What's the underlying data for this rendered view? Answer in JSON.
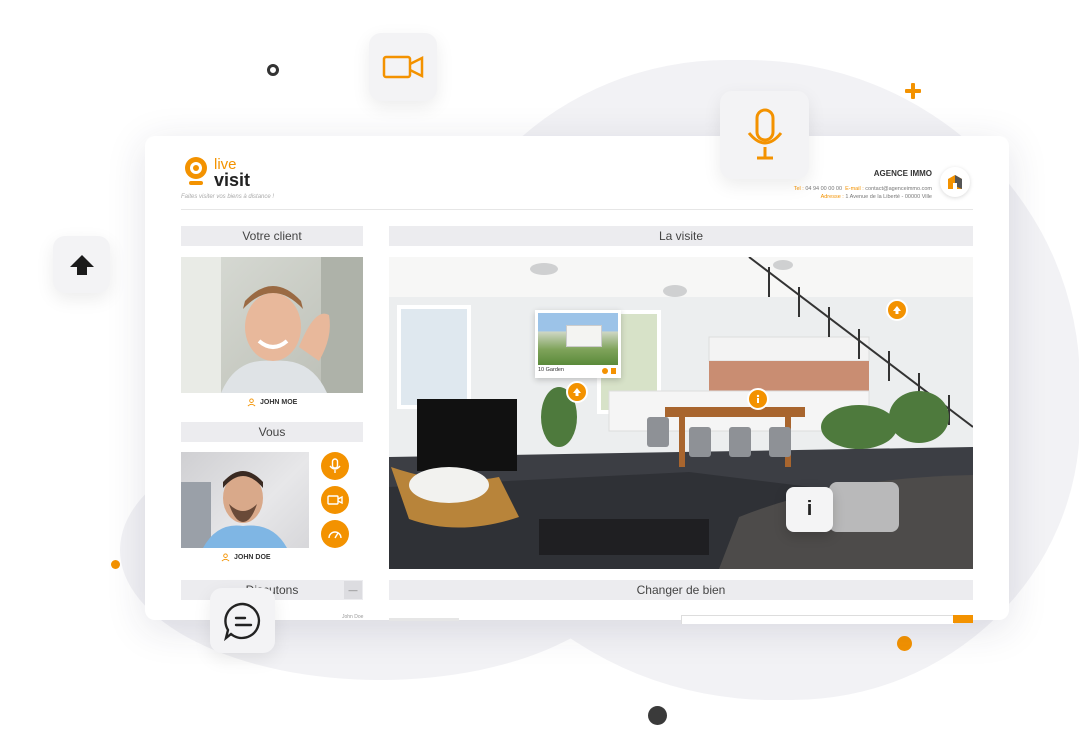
{
  "app": {
    "logo_live": "live",
    "logo_visit": "visit",
    "tagline": "Faites visiter vos biens à distance !"
  },
  "agency": {
    "name": "AGENCE IMMO",
    "tel_label": "Tel :",
    "tel": "04 94 00 00 00",
    "email_label": "E-mail :",
    "email": "contact@agenceimmo.com",
    "address_label": "Adresse :",
    "address": "1 Avenue de la Liberté - 00000 Ville"
  },
  "client": {
    "section_title": "Votre client",
    "name": "JOHN MOE"
  },
  "you": {
    "section_title": "Vous",
    "name": "JOHN DOE"
  },
  "chat": {
    "section_title": "Discutons",
    "minimize_label": "—",
    "message_author": "John Doe"
  },
  "visit": {
    "section_title": "La visite",
    "thumbnail_label": "10 Garden",
    "info_label": "i"
  },
  "change": {
    "section_title": "Changer de bien"
  },
  "colors": {
    "accent": "#f39200",
    "bar_bg": "#ececef",
    "dark_dot": "#3a3a3a"
  },
  "icons": {
    "camera": "video-camera-icon",
    "mic": "microphone-icon",
    "up": "arrow-up-icon",
    "chat": "chat-bubble-icon",
    "info": "info-icon"
  }
}
